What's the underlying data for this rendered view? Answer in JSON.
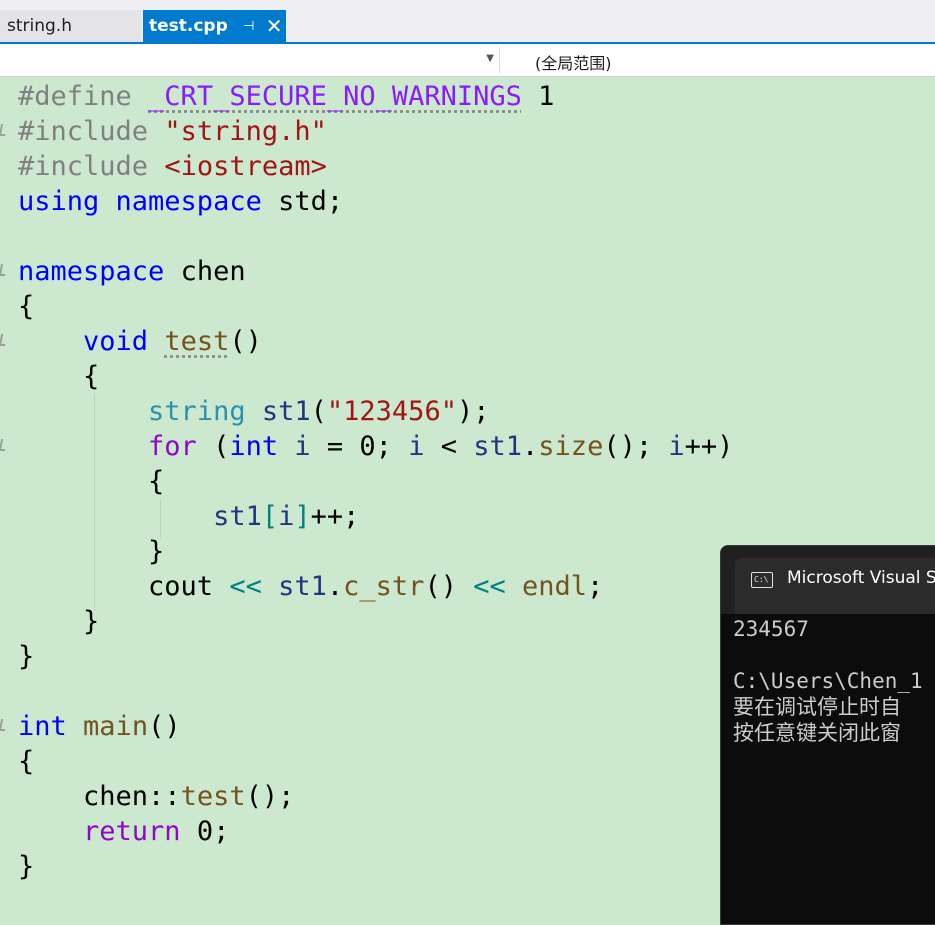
{
  "tabs": [
    {
      "label": "string.h",
      "active": false
    },
    {
      "label": "test.cpp",
      "active": true,
      "pin_icon": "pin-icon",
      "close_icon": "close-icon"
    }
  ],
  "navbar": {
    "project_dropdown": "",
    "scope_label": "(全局范围)"
  },
  "editor": {
    "language": "C++",
    "background": "#cce8cf",
    "lines": [
      "#define _CRT_SECURE_NO_WARNINGS 1",
      "#include \"string.h\"",
      "#include <iostream>",
      "using namespace std;",
      "",
      "namespace chen",
      "{",
      "    void test()",
      "    {",
      "        string st1(\"123456\");",
      "        for (int i = 0; i < st1.size(); i++)",
      "        {",
      "            st1[i]++;",
      "        }",
      "        cout << st1.c_str() << endl;",
      "    }",
      "}",
      "",
      "int main()",
      "{",
      "    chen::test();",
      "    return 0;",
      "}"
    ]
  },
  "console": {
    "title": "Microsoft Visual S",
    "output": [
      "234567",
      "",
      "C:\\Users\\Chen_1",
      "要在调试停止时自",
      "按任意键关闭此窗"
    ]
  },
  "colors": {
    "accent": "#007acc",
    "editor_bg": "#cce8cf",
    "console_bg": "#0c0c0c",
    "keyword": "#0000ff",
    "string": "#a31515",
    "type": "#2b91af",
    "function": "#74531f",
    "control": "#8f08c4"
  }
}
